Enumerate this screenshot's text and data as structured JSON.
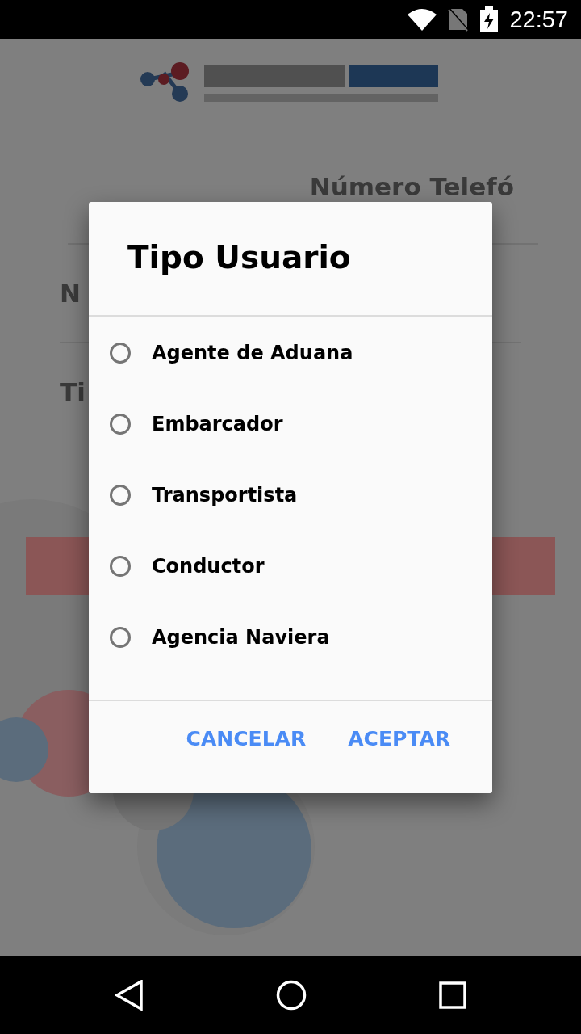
{
  "status_bar": {
    "time": "22:57"
  },
  "background_form": {
    "fields": [
      {
        "label": "Número Telefó"
      },
      {
        "label": "N"
      },
      {
        "label": "Ti"
      }
    ]
  },
  "dialog": {
    "title": "Tipo Usuario",
    "options": [
      {
        "label": "Agente de Aduana",
        "selected": false
      },
      {
        "label": "Embarcador",
        "selected": false
      },
      {
        "label": "Transportista",
        "selected": false
      },
      {
        "label": "Conductor",
        "selected": false
      },
      {
        "label": "Agencia Naviera",
        "selected": false
      }
    ],
    "buttons": [
      "CANCELAR",
      "ACEPTAR"
    ]
  }
}
